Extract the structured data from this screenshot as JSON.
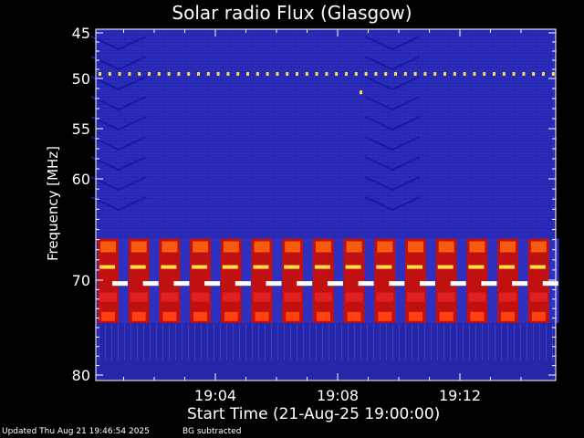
{
  "chart_data": {
    "type": "heatmap",
    "title": "Solar radio Flux (Glasgow)",
    "ylabel": "Frequency [MHz]",
    "xlabel": "Start Time (21-Aug-25 19:00:00)",
    "y_ticks": [
      {
        "value": 45,
        "label": "45"
      },
      {
        "value": 50,
        "label": "50"
      },
      {
        "value": 55,
        "label": "55"
      },
      {
        "value": 60,
        "label": "60"
      },
      {
        "value": 70,
        "label": "70"
      },
      {
        "value": 80,
        "label": "80"
      }
    ],
    "x_ticks": [
      {
        "value": 4,
        "label": "19:04"
      },
      {
        "value": 8,
        "label": "19:08"
      },
      {
        "value": 12,
        "label": "19:12"
      }
    ],
    "x_range_minutes": [
      0,
      15
    ],
    "y_range_mhz": [
      45,
      80
    ],
    "interference_bands_mhz": [
      49.5,
      66.5,
      68.7,
      70.4,
      74.5
    ],
    "burst_blocks": 15,
    "colors": {
      "background": "#000000",
      "spectrum_base": "#2a2ab8",
      "spectrum_dark": "#12128a",
      "burst_red": "#c01010",
      "burst_orange": "#ff6a10",
      "line_yellow": "#ffe040",
      "line_white": "#ffffff"
    }
  },
  "footer": {
    "updated": "Updated Thu Aug 21 19:46:54 2025",
    "note": "BG subtracted"
  }
}
